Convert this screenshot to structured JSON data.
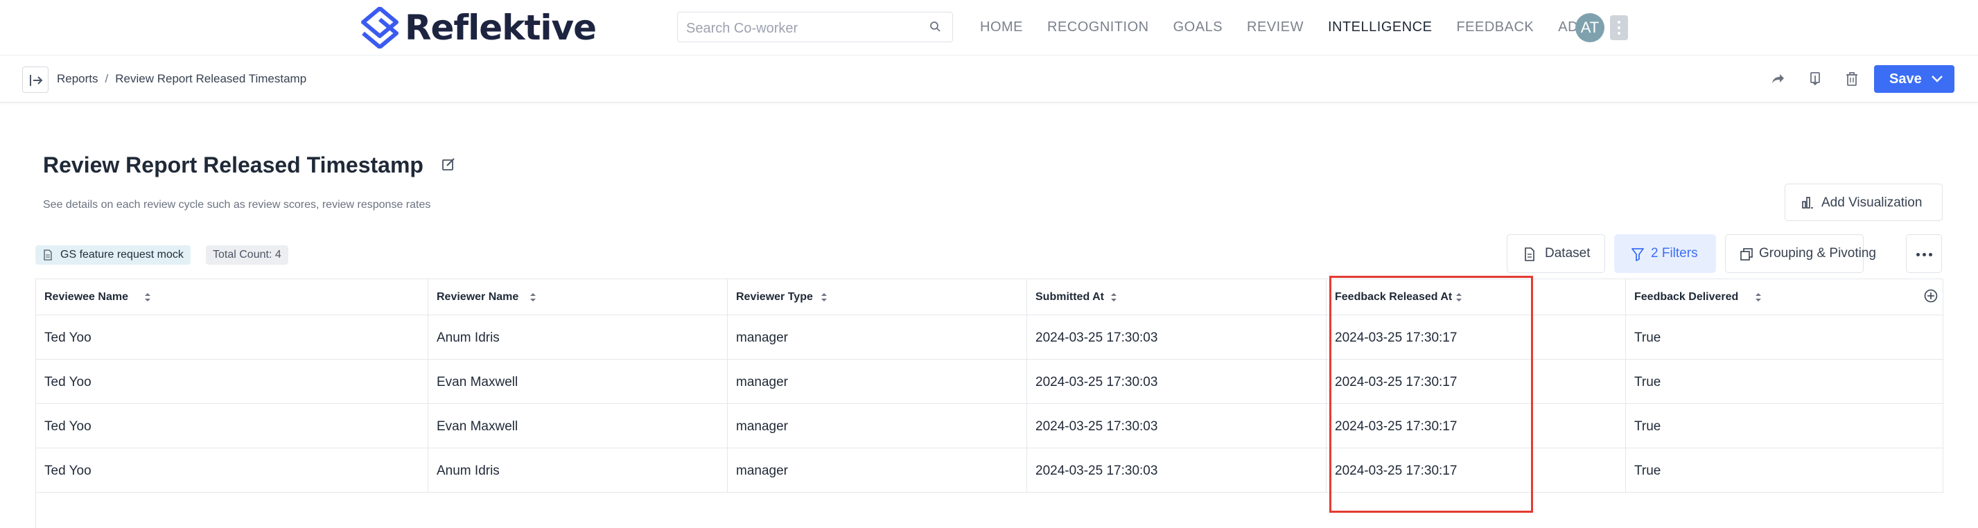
{
  "header": {
    "logo_text": "Reflektive",
    "search_placeholder": "Search Co-worker",
    "nav": [
      "HOME",
      "RECOGNITION",
      "GOALS",
      "REVIEW",
      "INTELLIGENCE",
      "FEEDBACK",
      "ADMIN"
    ],
    "active_nav": "INTELLIGENCE",
    "avatar_initials": "AT"
  },
  "breadcrumb": {
    "parent": "Reports",
    "separator": "/",
    "current": "Review Report Released Timestamp"
  },
  "toolbar": {
    "save_label": "Save",
    "icons": [
      "share-icon",
      "download-icon",
      "trash-icon"
    ]
  },
  "report": {
    "title": "Review Report Released Timestamp",
    "description": "See details on each review cycle such as review scores, review response rates",
    "add_visualization_label": "Add Visualization",
    "dataset_tag": "GS feature request mock",
    "total_count": "Total Count: 4",
    "controls": {
      "dataset": "Dataset",
      "filters": "2 Filters",
      "grouping": "Grouping & Pivoting"
    }
  },
  "table": {
    "columns": [
      "Reviewee Name",
      "Reviewer Name",
      "Reviewer Type",
      "Submitted At",
      "Feedback Released At",
      "Feedback Delivered"
    ],
    "rows": [
      [
        "Ted Yoo",
        "Anum Idris",
        "manager",
        "2024-03-25 17:30:03",
        "2024-03-25 17:30:17",
        "True"
      ],
      [
        "Ted Yoo",
        "Evan Maxwell",
        "manager",
        "2024-03-25 17:30:03",
        "2024-03-25 17:30:17",
        "True"
      ],
      [
        "Ted Yoo",
        "Evan Maxwell",
        "manager",
        "2024-03-25 17:30:03",
        "2024-03-25 17:30:17",
        "True"
      ],
      [
        "Ted Yoo",
        "Anum Idris",
        "manager",
        "2024-03-25 17:30:03",
        "2024-03-25 17:30:17",
        "True"
      ]
    ],
    "highlighted_column": "Feedback Released At"
  },
  "colors": {
    "accent": "#3b6ef5",
    "logo": "#3b5bf0",
    "highlight": "#e33b32",
    "tag_bg": "#e3f1f6"
  }
}
